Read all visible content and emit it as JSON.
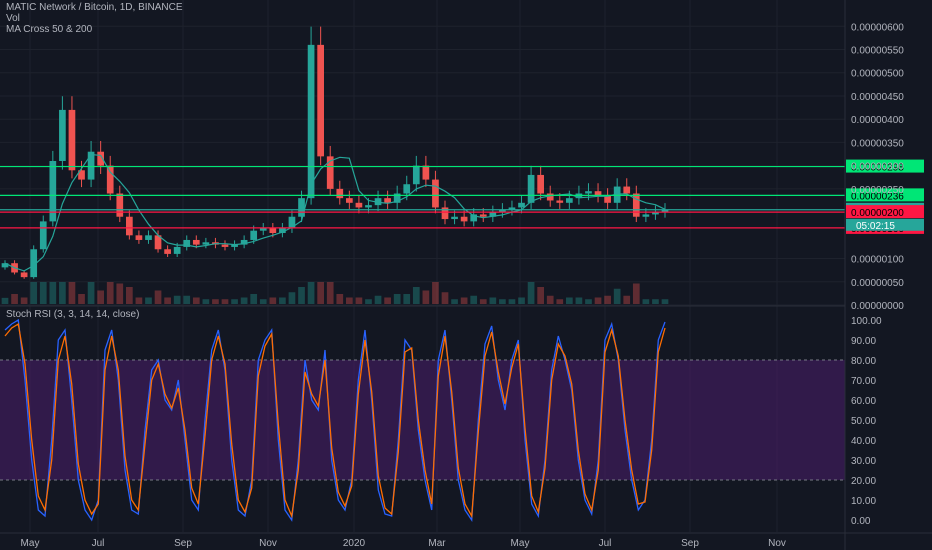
{
  "header": {
    "symbol_line": "MATIC Network / Bitcoin, 1D, BINANCE",
    "indicator_1": "Vol",
    "indicator_2": "MA Cross 50 & 200",
    "rsi_title": "Stoch RSI (3, 3, 14, 14, close)"
  },
  "colors": {
    "background": "#131722",
    "up": "#26a69a",
    "down": "#ef5350",
    "support_line": "#00e676",
    "resistance_red": "#ff1744",
    "ma_line": "#26a69a",
    "rsi_k": "#2962ff",
    "rsi_d": "#ff6d00",
    "rsi_band": "#4a1e6b"
  },
  "chart_data": [
    {
      "type": "line",
      "title": "MATIC Network / Bitcoin, 1D, BINANCE",
      "x_ticks": [
        "May",
        "Jul",
        "Sep",
        "Nov",
        "2020",
        "Mar",
        "May",
        "Jul",
        "Sep",
        "Nov"
      ],
      "y_ticks": [
        "0.00000600",
        "0.00000550",
        "0.00000500",
        "0.00000450",
        "0.00000400",
        "0.00000350",
        "0.00000300",
        "0.00000250",
        "0.00000100",
        "0.00000050",
        "0.00000000"
      ],
      "ylim": [
        0,
        6.2e-06
      ],
      "price_series": [
        9e-07,
        7e-07,
        6e-07,
        1.2e-06,
        1.8e-06,
        3.1e-06,
        4.2e-06,
        2.9e-06,
        2.7e-06,
        3.3e-06,
        3e-06,
        2.4e-06,
        1.9e-06,
        1.5e-06,
        1.4e-06,
        1.5e-06,
        1.2e-06,
        1.1e-06,
        1.25e-06,
        1.4e-06,
        1.3e-06,
        1.35e-06,
        1.3e-06,
        1.25e-06,
        1.3e-06,
        1.4e-06,
        1.6e-06,
        1.65e-06,
        1.55e-06,
        1.65e-06,
        1.9e-06,
        2.3e-06,
        5.6e-06,
        3.2e-06,
        2.5e-06,
        2.3e-06,
        2.2e-06,
        2.1e-06,
        2.15e-06,
        2.3e-06,
        2.2e-06,
        2.4e-06,
        2.6e-06,
        3e-06,
        2.7e-06,
        2.1e-06,
        1.85e-06,
        1.9e-06,
        1.8e-06,
        1.95e-06,
        1.9e-06,
        2e-06,
        2.05e-06,
        2.1e-06,
        2.2e-06,
        2.8e-06,
        2.4e-06,
        2.25e-06,
        2.2e-06,
        2.3e-06,
        2.4e-06,
        2.45e-06,
        2.35e-06,
        2.2e-06,
        2.55e-06,
        2.4e-06,
        1.9e-06,
        1.95e-06,
        2e-06,
        2.05e-06
      ],
      "horizontal_levels": [
        {
          "label": "0.00000298",
          "value": 2.98e-06,
          "color": "#00e676"
        },
        {
          "label": "0.00000236",
          "value": 2.36e-06,
          "color": "#00e676"
        },
        {
          "label": "0.00000205",
          "value": 2.05e-06,
          "color": "#26a69a"
        },
        {
          "label": "0.00000200",
          "value": 2e-06,
          "color": "#ff1744"
        },
        {
          "label": "0.00000166",
          "value": 1.66e-06,
          "color": "#ff1744"
        }
      ],
      "countdown_label": "05:02:15"
    },
    {
      "type": "line",
      "title": "Stoch RSI (3, 3, 14, 14, close)",
      "y_ticks": [
        "100.00",
        "90.00",
        "80.00",
        "70.00",
        "60.00",
        "50.00",
        "40.00",
        "30.00",
        "20.00",
        "10.00",
        "0.00"
      ],
      "ylim": [
        -5,
        100
      ],
      "band": [
        20,
        80
      ],
      "series": [
        {
          "values": [
            95,
            98,
            100,
            70,
            30,
            5,
            2,
            40,
            90,
            95,
            60,
            20,
            5,
            0,
            10,
            85,
            95,
            70,
            25,
            5,
            3,
            45,
            75,
            80,
            60,
            55,
            70,
            40,
            10,
            5,
            50,
            85,
            95,
            75,
            30,
            5,
            2,
            20,
            80,
            90,
            95,
            40,
            5,
            0,
            30,
            80,
            60,
            55,
            85,
            30,
            10,
            5,
            20,
            70,
            95,
            60,
            15,
            3,
            2,
            40,
            90,
            85,
            45,
            20,
            5,
            80,
            95,
            60,
            20,
            5,
            0,
            50,
            88,
            97,
            70,
            55,
            80,
            90,
            40,
            8,
            2,
            30,
            75,
            92,
            80,
            65,
            30,
            10,
            3,
            30,
            90,
            98,
            80,
            45,
            20,
            5,
            10,
            40,
            90,
            99
          ]
        },
        {
          "values": [
            92,
            96,
            98,
            78,
            40,
            12,
            5,
            30,
            80,
            92,
            68,
            28,
            10,
            3,
            8,
            75,
            92,
            75,
            32,
            10,
            5,
            38,
            70,
            78,
            63,
            56,
            66,
            45,
            16,
            8,
            42,
            80,
            92,
            78,
            38,
            10,
            4,
            16,
            72,
            87,
            93,
            48,
            10,
            2,
            25,
            74,
            63,
            57,
            80,
            36,
            14,
            7,
            17,
            63,
            90,
            64,
            22,
            6,
            3,
            34,
            84,
            86,
            50,
            25,
            8,
            72,
            92,
            64,
            26,
            8,
            2,
            44,
            82,
            94,
            74,
            58,
            76,
            88,
            46,
            12,
            4,
            26,
            70,
            88,
            82,
            68,
            35,
            13,
            5,
            25,
            84,
            95,
            82,
            50,
            25,
            8,
            9,
            35,
            84,
            96
          ]
        }
      ]
    }
  ]
}
